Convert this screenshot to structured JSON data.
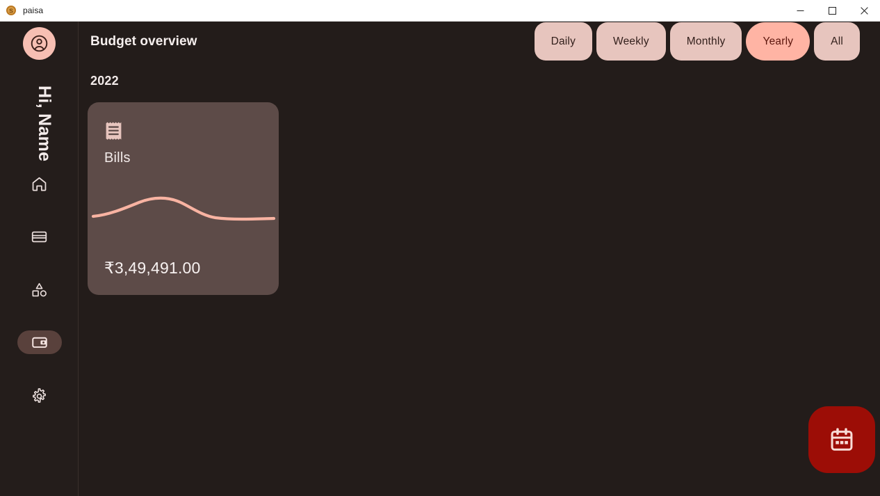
{
  "window": {
    "title": "paisa",
    "app_icon": "coin-dollar-icon",
    "controls": [
      {
        "name": "minimize",
        "icon": "minimize-icon"
      },
      {
        "name": "maximize",
        "icon": "maximize-icon"
      },
      {
        "name": "close",
        "icon": "close-icon"
      }
    ]
  },
  "sidebar": {
    "avatar_icon": "account-circle-icon",
    "greeting": "Hi, Name",
    "items": [
      {
        "label": "Home",
        "icon": "home-icon",
        "active": false
      },
      {
        "label": "Accounts",
        "icon": "credit-card-icon",
        "active": false
      },
      {
        "label": "Categories",
        "icon": "shapes-icon",
        "active": false
      },
      {
        "label": "Budget",
        "icon": "wallet-icon",
        "active": true
      },
      {
        "label": "Settings",
        "icon": "gear-icon",
        "active": false
      }
    ]
  },
  "header": {
    "title": "Budget overview",
    "subtitle": "2022"
  },
  "filters": {
    "options": [
      {
        "label": "Daily",
        "selected": false
      },
      {
        "label": "Weekly",
        "selected": false
      },
      {
        "label": "Monthly",
        "selected": false
      },
      {
        "label": "Yearly",
        "selected": true
      },
      {
        "label": "All",
        "selected": false
      }
    ],
    "selected": "Yearly"
  },
  "budget_cards": [
    {
      "icon": "receipt-icon",
      "label": "Bills",
      "amount": "₹3,49,491.00",
      "currency_symbol": "₹",
      "value": 349491.0
    }
  ],
  "fab": {
    "icon": "calendar-icon",
    "label": "Select date range"
  },
  "colors": {
    "background": "#231c1a",
    "sidebar": "#241d1b",
    "card": "#5d4b48",
    "chip": "#e7c5be",
    "chip_selected": "#ffb4a4",
    "chip_selected_text": "#5c160d",
    "accent_salmon": "#f8b3a2",
    "fab": "#9c0d06",
    "text_primary": "#f4eceb",
    "titlebar": "#ffffff"
  },
  "chart_data": {
    "type": "line",
    "title": "Bills",
    "xlabel": "",
    "ylabel": "",
    "x": [
      0,
      1,
      2,
      3,
      4,
      5,
      6,
      7,
      8
    ],
    "values": [
      12,
      30,
      55,
      62,
      52,
      28,
      12,
      10,
      10
    ],
    "ylim": [
      0,
      70
    ],
    "grid": false,
    "legend": "none",
    "line_color": "#f8b3a2"
  }
}
